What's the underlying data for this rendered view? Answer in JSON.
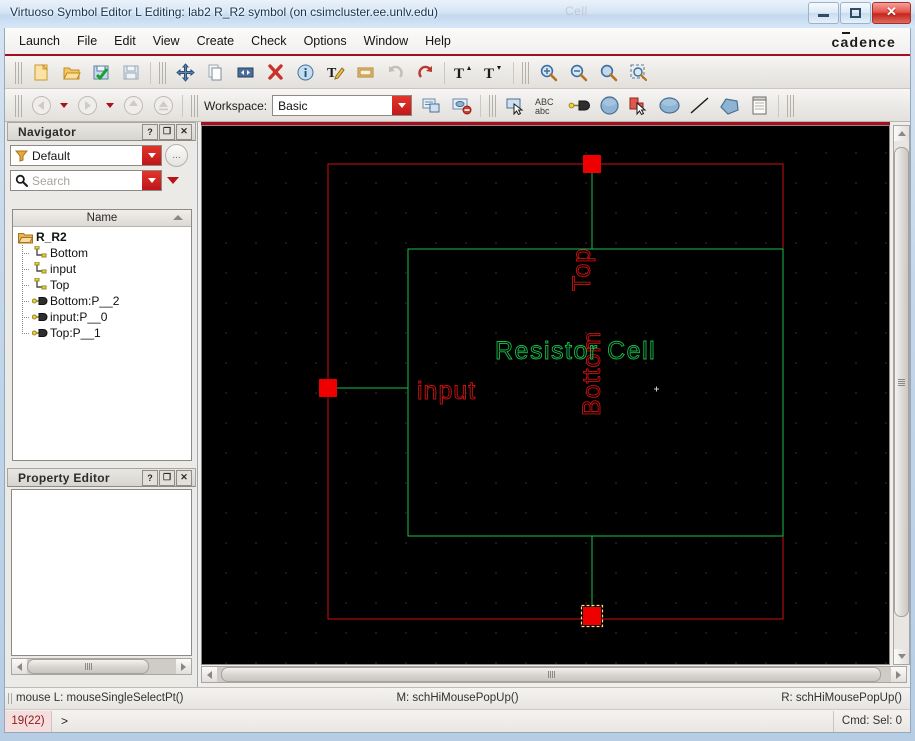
{
  "window": {
    "title": "Virtuoso Symbol Editor L Editing: lab2 R_R2 symbol (on csimcluster.ee.unlv.edu)",
    "ghost_text": "Cell",
    "minimize": "–",
    "maximize": "□",
    "close": "✕"
  },
  "menubar": {
    "items": [
      "Launch",
      "File",
      "Edit",
      "View",
      "Create",
      "Check",
      "Options",
      "Window",
      "Help"
    ],
    "logo": "cadence"
  },
  "toolbar1": {
    "icons": [
      "new-file-icon",
      "open-folder-icon",
      "save-check-icon",
      "save-disk-icon",
      "move-icon",
      "copy-icon",
      "stretch-icon",
      "delete-icon",
      "properties-info-icon",
      "edit-text-icon",
      "label-icon",
      "undo-icon",
      "redo-icon",
      "text-up-icon",
      "text-down-icon",
      "zoom-in-icon",
      "zoom-out-icon",
      "zoom-fit-icon",
      "zoom-area-icon"
    ]
  },
  "toolbar2": {
    "nav_icons": [
      "back-icon",
      "back-dropdown-icon",
      "forward-icon",
      "forward-dropdown-icon",
      "up-level-icon",
      "top-level-icon"
    ],
    "workspace_label": "Workspace:",
    "workspace_value": "Basic",
    "workspace_options": [
      "Basic"
    ],
    "right_icons": [
      "save-workspace-icon",
      "delete-workspace-icon",
      "select-arrow-icon",
      "text-abc-icon",
      "pin-icon",
      "circle-shape-icon",
      "instance-icon",
      "ellipse-shape-icon",
      "line-shape-icon",
      "polygon-shape-icon",
      "note-icon"
    ]
  },
  "navigator": {
    "title": "Navigator",
    "help_btn": "?",
    "float_btn": "❐",
    "close_btn": "✕",
    "filter_value": "Default",
    "filter_icon": "funnel-icon",
    "options_btn": "...",
    "search_placeholder": "Search",
    "search_icon": "magnifier-icon",
    "column_header": "Name",
    "tree": [
      {
        "label": "R_R2",
        "icon": "folder-icon",
        "depth": 0,
        "bold": true
      },
      {
        "label": "Bottom",
        "icon": "pin-shape-icon",
        "depth": 1,
        "bold": false
      },
      {
        "label": "input",
        "icon": "pin-shape-icon",
        "depth": 1,
        "bold": false
      },
      {
        "label": "Top",
        "icon": "pin-shape-icon",
        "depth": 1,
        "bold": false
      },
      {
        "label": "Bottom:P__2",
        "icon": "terminal-icon",
        "depth": 1,
        "bold": false
      },
      {
        "label": "input:P__0",
        "icon": "terminal-icon",
        "depth": 1,
        "bold": false
      },
      {
        "label": "Top:P__1",
        "icon": "terminal-icon",
        "depth": 1,
        "bold": false
      }
    ]
  },
  "property_editor": {
    "title": "Property Editor",
    "help_btn": "?",
    "float_btn": "❐",
    "close_btn": "✕",
    "content": ""
  },
  "canvas": {
    "background": "#000000",
    "selection_box_color": "#cc1111",
    "body_color": "#18bf4a",
    "pin_color": "#ee0000",
    "label_color": "#cc1111",
    "cell_label": "Resistor Cell",
    "cell_label_color": "#18bf4a",
    "pin_labels": {
      "top": "Top",
      "input": "input",
      "bottom": "Bottom"
    },
    "selected_pin": "Bottom"
  },
  "statusbar": {
    "left": "mouse L: mouseSingleSelectPt()",
    "middle": "M: schHiMousePopUp()",
    "right": "R: schHiMousePopUp()"
  },
  "commandbar": {
    "count": "19(22)",
    "prompt": ">",
    "selection": "Cmd: Sel: 0"
  }
}
